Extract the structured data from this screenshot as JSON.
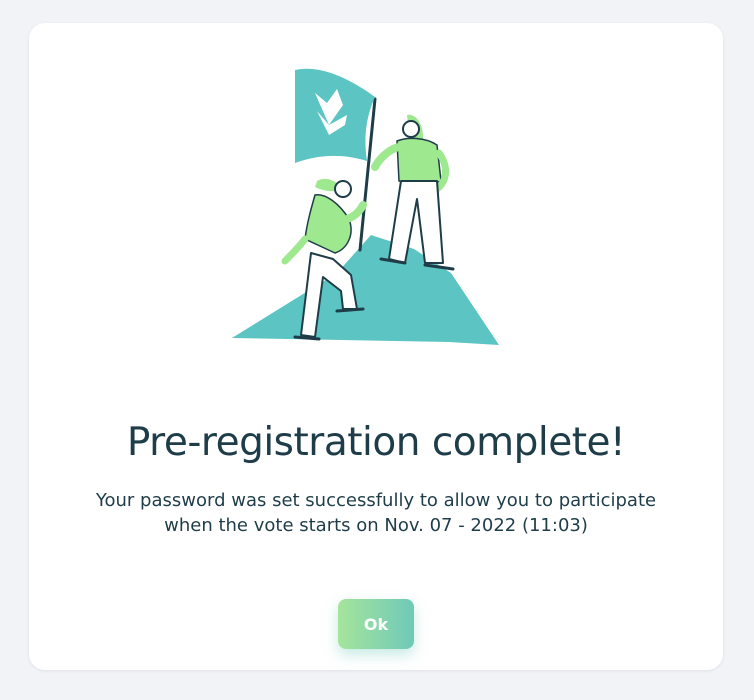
{
  "dialog": {
    "title": "Pre-registration complete!",
    "message_line1": "Your password was set successfully to allow you to participate",
    "message_line2": "when the vote starts on Nov. 07 - 2022 (11:03)",
    "ok_label": "Ok"
  },
  "illustration": {
    "icon": "mountain-flag-illustration",
    "colors": {
      "teal": "#5cc4c2",
      "green": "#9ee88f",
      "ink": "#1f3d49"
    }
  },
  "colors": {
    "page_background": "#f1f3f7",
    "card_background": "#ffffff",
    "text": "#1f3d49",
    "button_gradient_start": "#a5e59c",
    "button_gradient_end": "#6fc9b8"
  }
}
